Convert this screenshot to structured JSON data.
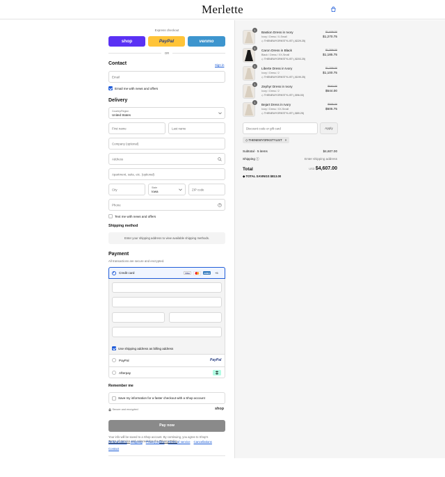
{
  "brand": "Merlette",
  "express": {
    "title": "Express checkout",
    "shop_label": "shop",
    "paypal_label": "PayPal",
    "venmo_label": "venmo",
    "or_label": "OR"
  },
  "contact": {
    "heading": "Contact",
    "sign_in": "Sign in",
    "email_placeholder": "Email",
    "news_label": "Email me with news and offers"
  },
  "delivery": {
    "heading": "Delivery",
    "country_label": "Country/Region",
    "country_value": "United States",
    "first_name": "First name",
    "last_name": "Last name",
    "company": "Company (optional)",
    "address": "Address",
    "apartment": "Apartment, suite, etc. (optional)",
    "city": "City",
    "state_label": "State",
    "state_value": "Iowa",
    "zip": "ZIP code",
    "phone": "Phone",
    "text_label": "Text me with news and offers"
  },
  "shipping_method": {
    "heading": "Shipping method",
    "note": "Enter your shipping address to view available shipping methods."
  },
  "payment": {
    "heading": "Payment",
    "secure": "All transactions are secure and encrypted.",
    "credit_card": "Credit card",
    "cards": [
      "VISA",
      "MC",
      "AMEX"
    ],
    "more_cards": "+5",
    "billing_same": "Use shipping address as billing address",
    "paypal": "PayPal",
    "paypal_logo": "PayPal",
    "afterpay": "Afterpay"
  },
  "remember": {
    "heading": "Remember me",
    "save_label": "Save my information for a faster checkout with a Shop account",
    "secure": "Secure and encrypted",
    "shop_logo": "shop"
  },
  "pay_now": "Pay now",
  "legal": {
    "text1": "Your info will be saved to a Shop account. By continuing, you agree to Shop's",
    "terms": "Terms of Service",
    "text2": "and acknowledge the",
    "privacy": "Privacy Policy",
    "end": "."
  },
  "footer_links": [
    "Refund policy",
    "Shipping",
    "Privacy policy",
    "Terms of service",
    "Cancellations",
    "Contact"
  ],
  "order": {
    "items": [
      {
        "name": "Bastion Dress in Ivory",
        "variant": "Ivory / Dress / X-Small",
        "code": "THENEWYORKSTYLIST (-$229.25)",
        "old_price": "$1,499.00",
        "price": "$1,270.75",
        "qty": "1"
      },
      {
        "name": "Caron Dress in Black",
        "variant": "Black / Dress / XX-Small",
        "code": "THENEWYORKSTYLIST (-$203.25)",
        "old_price": "$1,399.00",
        "price": "$1,185.75",
        "qty": "1"
      },
      {
        "name": "Liberte Dress in Ivory",
        "variant": "Ivory / Dress / 2",
        "code": "THENEWYORKSTYLIST (-$199.25)",
        "old_price": "$1,299.00",
        "price": "$1,100.75",
        "qty": "1"
      },
      {
        "name": "Zephyr Dress in Ivory",
        "variant": "Ivory / Dress / 2",
        "code": "THENEWYORKSTYLIST (-$96.00)",
        "old_price": "$640.00",
        "price": "$544.00",
        "qty": "1"
      },
      {
        "name": "Bejart Dress in Ivory",
        "variant": "Ivory / Dress / XX-Small",
        "code": "THENEWYORKSTYLIST (-$89.25)",
        "old_price": "$595.00",
        "price": "$505.75",
        "qty": "1"
      }
    ],
    "discount_placeholder": "Discount code or gift card",
    "apply": "Apply",
    "applied_code": "THENEWYORKSTYLIST",
    "subtotal_label": "Subtotal · 5 items",
    "subtotal_value": "$4,607.00",
    "shipping_label": "Shipping",
    "shipping_value": "Enter shipping address",
    "total_label": "Total",
    "currency": "USD",
    "total_value": "$4,607.00",
    "savings_label": "TOTAL SAVINGS",
    "savings_value": "$813.00"
  },
  "colors": {
    "accent": "#1e5bd8",
    "shop": "#5a31f4",
    "paypal": "#ffc439",
    "venmo": "#3d95ce",
    "pay_button": "#8a8a8a"
  }
}
